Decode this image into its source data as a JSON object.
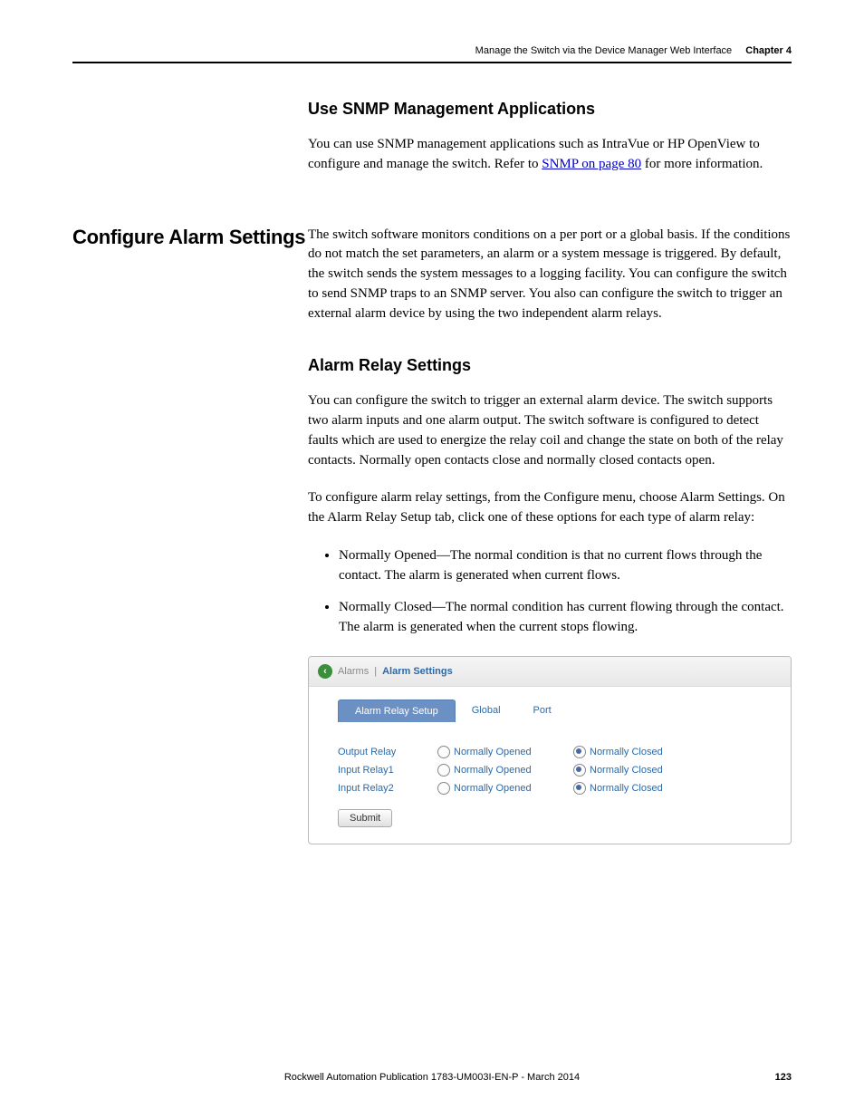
{
  "header": {
    "title": "Manage the Switch via the Device Manager Web Interface",
    "chapter": "Chapter 4"
  },
  "snmp": {
    "heading": "Use SNMP Management Applications",
    "para_pre": "You can use SNMP management applications such as IntraVue or HP OpenView to configure and manage the switch. Refer to ",
    "link": "SNMP on page 80",
    "para_post": " for more information."
  },
  "alarm": {
    "side_heading": "Configure Alarm Settings",
    "intro": "The switch software monitors conditions on a per port or a global basis. If the conditions do not match the set parameters, an alarm or a system message is triggered. By default, the switch sends the system messages to a logging facility. You can configure the switch to send SNMP traps to an SNMP server. You also can configure the switch to trigger an external alarm device by using the two independent alarm relays."
  },
  "relay": {
    "heading": "Alarm Relay Settings",
    "para1": "You can configure the switch to trigger an external alarm device. The switch supports two alarm inputs and one alarm output. The switch software is configured to detect faults which are used to energize the relay coil and change the state on both of the relay contacts. Normally open contacts close and normally closed contacts open.",
    "para2": "To configure alarm relay settings, from the Configure menu, choose Alarm Settings. On the Alarm Relay Setup tab, click one of these options for each type of alarm relay:",
    "bullets": [
      "Normally Opened—The normal condition is that no current flows through the contact. The alarm is generated when current flows.",
      "Normally Closed—The normal condition has current flowing through the contact. The alarm is generated when the current stops flowing."
    ]
  },
  "ui": {
    "crumb_parent": "Alarms",
    "crumb_sep": "|",
    "crumb_current": "Alarm Settings",
    "tabs": [
      "Alarm Relay Setup",
      "Global",
      "Port"
    ],
    "active_tab": 0,
    "option_opened": "Normally Opened",
    "option_closed": "Normally Closed",
    "rows": [
      {
        "label": "Output Relay",
        "selected": "closed"
      },
      {
        "label": "Input Relay1",
        "selected": "closed"
      },
      {
        "label": "Input Relay2",
        "selected": "closed"
      }
    ],
    "submit": "Submit"
  },
  "footer": {
    "pub": "Rockwell Automation Publication 1783-UM003I-EN-P - March 2014",
    "page": "123"
  }
}
